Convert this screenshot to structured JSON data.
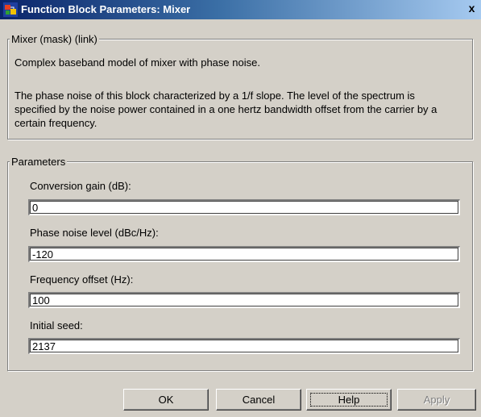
{
  "window": {
    "title": "Function Block Parameters: Mixer",
    "close_glyph": "x",
    "icon": "simulink-block-icon"
  },
  "description_group": {
    "legend": "Mixer (mask) (link)",
    "summary": "Complex baseband model of mixer with phase noise.",
    "detail": "The phase noise of this block characterized by a 1/f slope.  The level of the spectrum is specified by the noise power contained in a one hertz bandwidth offset from the carrier by a certain frequency."
  },
  "parameters_group": {
    "legend": "Parameters",
    "fields": [
      {
        "label": "Conversion gain (dB):",
        "value": "0"
      },
      {
        "label": "Phase noise level (dBc/Hz):",
        "value": "-120"
      },
      {
        "label": "Frequency offset (Hz):",
        "value": "100"
      },
      {
        "label": "Initial seed:",
        "value": "2137"
      }
    ]
  },
  "buttons": {
    "ok": "OK",
    "cancel": "Cancel",
    "help": "Help",
    "apply": "Apply"
  },
  "colors": {
    "title_bar_start": "#0a246a",
    "title_bar_end": "#a6caf0",
    "dialog_face": "#d4d0c8"
  }
}
